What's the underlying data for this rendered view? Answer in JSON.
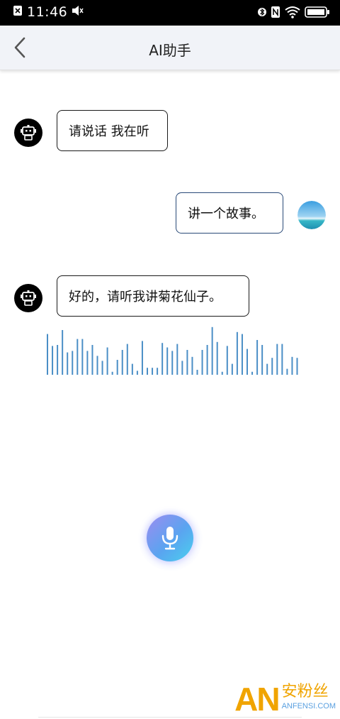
{
  "status_bar": {
    "time": "11:46",
    "icons": [
      "close-box-icon",
      "speaker-icon",
      "bluetooth-icon",
      "nfc-icon",
      "wifi-icon",
      "battery-icon"
    ]
  },
  "header": {
    "title": "AI助手",
    "back_icon": "chevron-left-icon"
  },
  "messages": [
    {
      "sender": "bot",
      "text": "请说话 我在听"
    },
    {
      "sender": "user",
      "text": "讲一个故事。"
    },
    {
      "sender": "bot",
      "text": "好的，请听我讲菊花仙子。"
    }
  ],
  "waveform": {
    "color": "#4a8ec6",
    "levels": [
      0.82,
      0.58,
      0.6,
      0.9,
      0.45,
      0.48,
      0.72,
      0.72,
      0.48,
      0.6,
      0.38,
      0.28,
      0.55,
      0.06,
      0.3,
      0.5,
      0.62,
      0.22,
      0.08,
      0.68,
      0.14,
      0.14,
      0.14,
      0.64,
      0.55,
      0.48,
      0.62,
      0.28,
      0.5,
      0.36,
      0.1,
      0.5,
      0.6,
      0.96,
      0.66,
      0.06,
      0.58,
      0.22,
      0.86,
      0.82,
      0.52,
      0.06,
      0.7,
      0.6,
      0.22,
      0.34,
      0.62,
      0.62,
      0.12,
      0.36,
      0.34
    ]
  },
  "mic": {
    "icon": "microphone-icon"
  },
  "watermark": {
    "logo": "AN",
    "cn": "安粉丝",
    "en": "ANFENSI.COM"
  },
  "colors": {
    "accent_blue": "#4a8ec6",
    "user_bubble_border": "#2a4a78"
  }
}
